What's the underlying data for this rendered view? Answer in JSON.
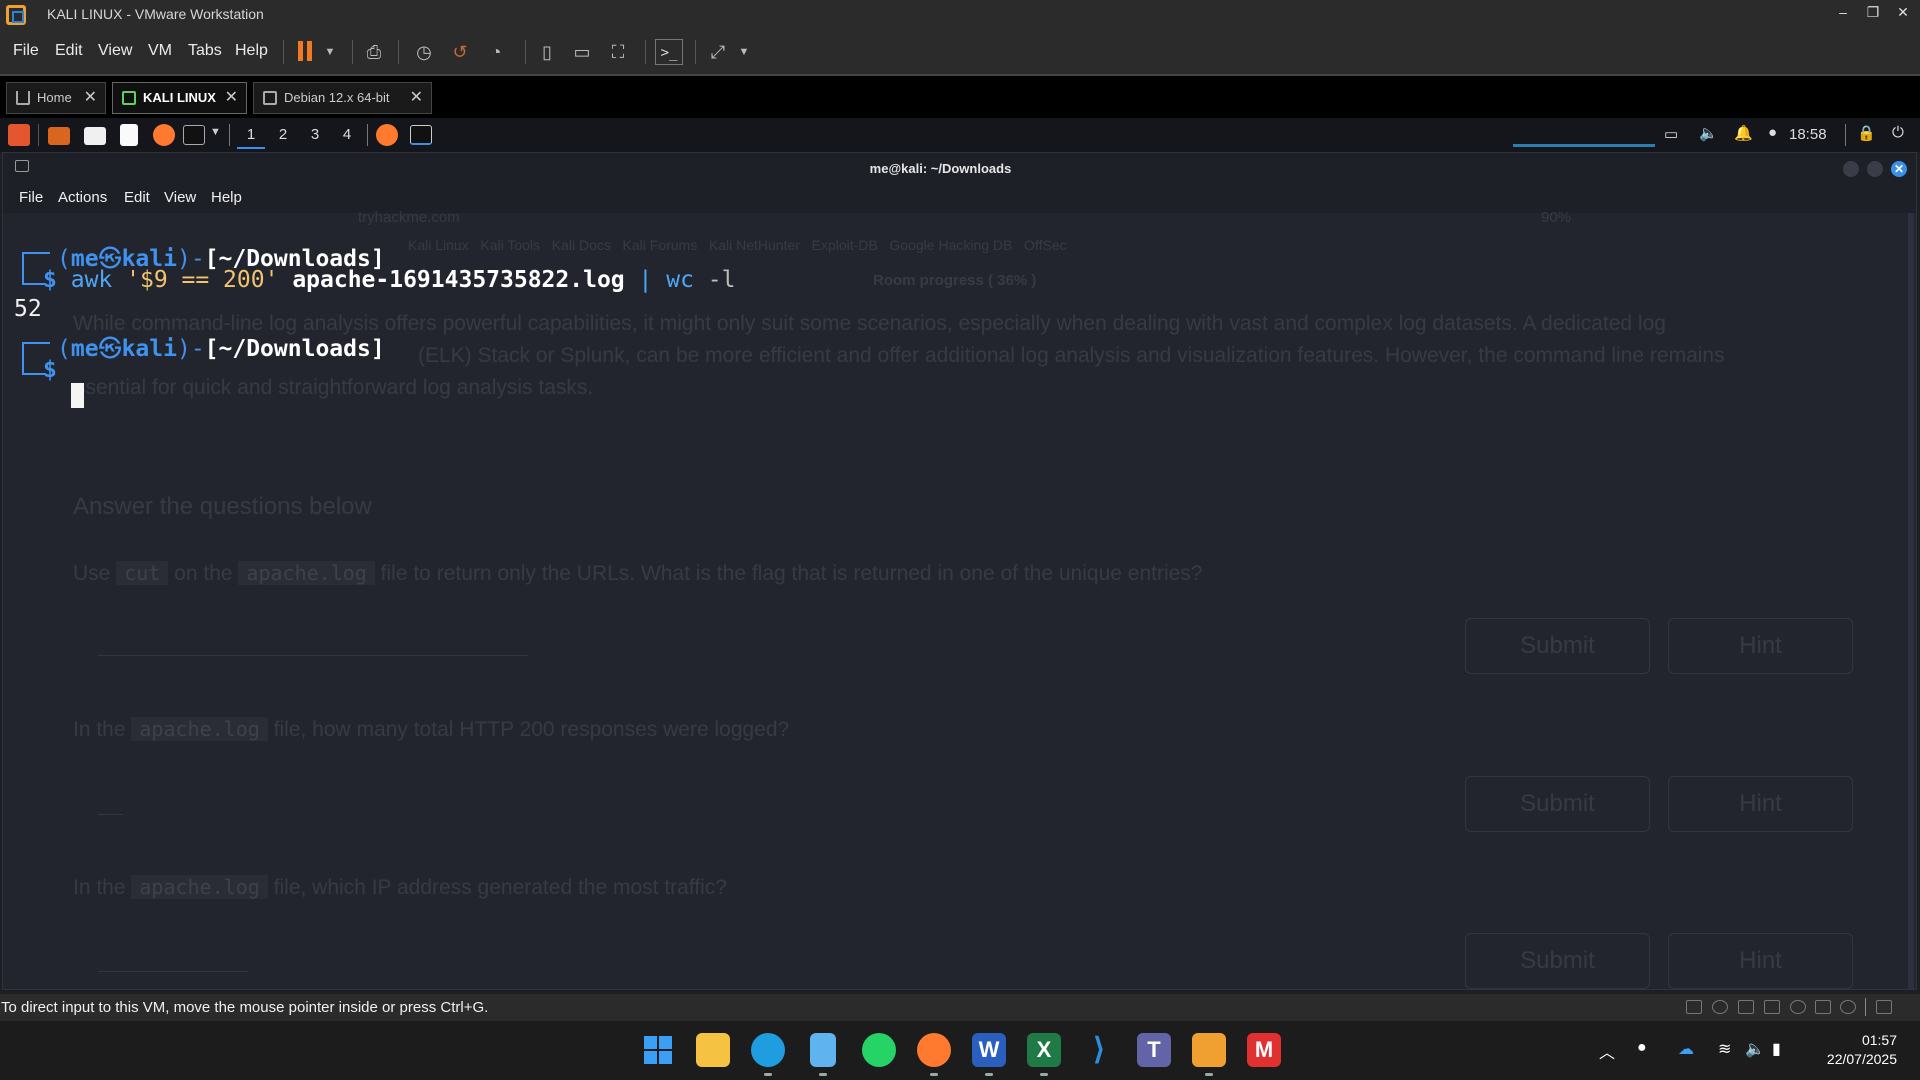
{
  "window": {
    "title": "KALI LINUX - VMware Workstation",
    "minimize": "–",
    "restore": "❐",
    "close": "✕"
  },
  "vmmenu": [
    "File",
    "Edit",
    "View",
    "VM",
    "Tabs",
    "Help"
  ],
  "vmtabs": [
    {
      "label": "Home",
      "icon": "home-icon"
    },
    {
      "label": "KALI LINUX",
      "icon": "vm-running-icon",
      "active": true
    },
    {
      "label": "Debian 12.x 64-bit",
      "icon": "vm-icon"
    }
  ],
  "kali_panel": {
    "workspaces": [
      "1",
      "2",
      "3",
      "4"
    ],
    "active_workspace": "1",
    "time": "18:58"
  },
  "terminal": {
    "title": "me@kali: ~/Downloads",
    "menu": [
      "File",
      "Actions",
      "Edit",
      "View",
      "Help"
    ],
    "prompt": {
      "open": "(",
      "user": "me",
      "at": "㉿",
      "host": "kali",
      "close": ")",
      "dash": "-",
      "path": "[~/Downloads]",
      "dollar": "$"
    },
    "command": {
      "cmd": "awk",
      "arg": "'$9 == 200'",
      "file": "apache-1691435735822.log",
      "pipe": "|",
      "cmd2": "wc",
      "flag": "-l"
    },
    "output": "52"
  },
  "background_page": {
    "url": "tryhackme.com",
    "bookmarks": [
      "Kali Linux",
      "Kali Tools",
      "Kali Docs",
      "Kali Forums",
      "Kali NetHunter",
      "Exploit-DB",
      "Google Hacking DB",
      "OffSec"
    ],
    "zoom": "90%",
    "progress": "Room progress ( 36% )",
    "paragraph": [
      "While command-line log analysis offers powerful capabilities, it might only suit some scenarios, especially when dealing with vast and complex log datasets. A dedicated log",
      "(ELK) Stack or Splunk, can be more efficient and offer additional log analysis and visualization features. However, the command line remains",
      "ssential for quick and straightforward log analysis tasks."
    ],
    "answer_heading": "Answer the questions below",
    "q1": {
      "pre": "Use",
      "code1": "cut",
      "mid": "on the",
      "code2": "apache.log",
      "post": "file to return only the URLs. What is the flag that is returned in one of the unique entries?"
    },
    "q2": {
      "pre": "In the",
      "code": "apache.log",
      "post": "file, how many total HTTP 200 responses were logged?"
    },
    "q3": {
      "pre": "In the",
      "code": "apache.log",
      "post": "file, which IP address generated the most traffic?"
    },
    "submit": "Submit",
    "hint": "Hint"
  },
  "status": {
    "message": "To direct input to this VM, move the mouse pointer inside or press Ctrl+G."
  },
  "taskbar": {
    "apps": [
      {
        "name": "start",
        "color": "#3aa0f5"
      },
      {
        "name": "file-explorer",
        "color": "#f5c242"
      },
      {
        "name": "edge",
        "color": "#1f9de0"
      },
      {
        "name": "notepad",
        "color": "#5fb4f0"
      },
      {
        "name": "whatsapp",
        "color": "#25d366"
      },
      {
        "name": "firefox",
        "color": "#ff7a2e"
      },
      {
        "name": "word",
        "color": "#2b5fbf"
      },
      {
        "name": "excel",
        "color": "#1f7a45"
      },
      {
        "name": "vscode",
        "color": "#2a8fe0"
      },
      {
        "name": "teams",
        "color": "#6264a7"
      },
      {
        "name": "vmware",
        "color": "#f0a030"
      },
      {
        "name": "red-app",
        "color": "#e03030"
      }
    ],
    "time": "01:57",
    "date": "22/07/2025"
  }
}
